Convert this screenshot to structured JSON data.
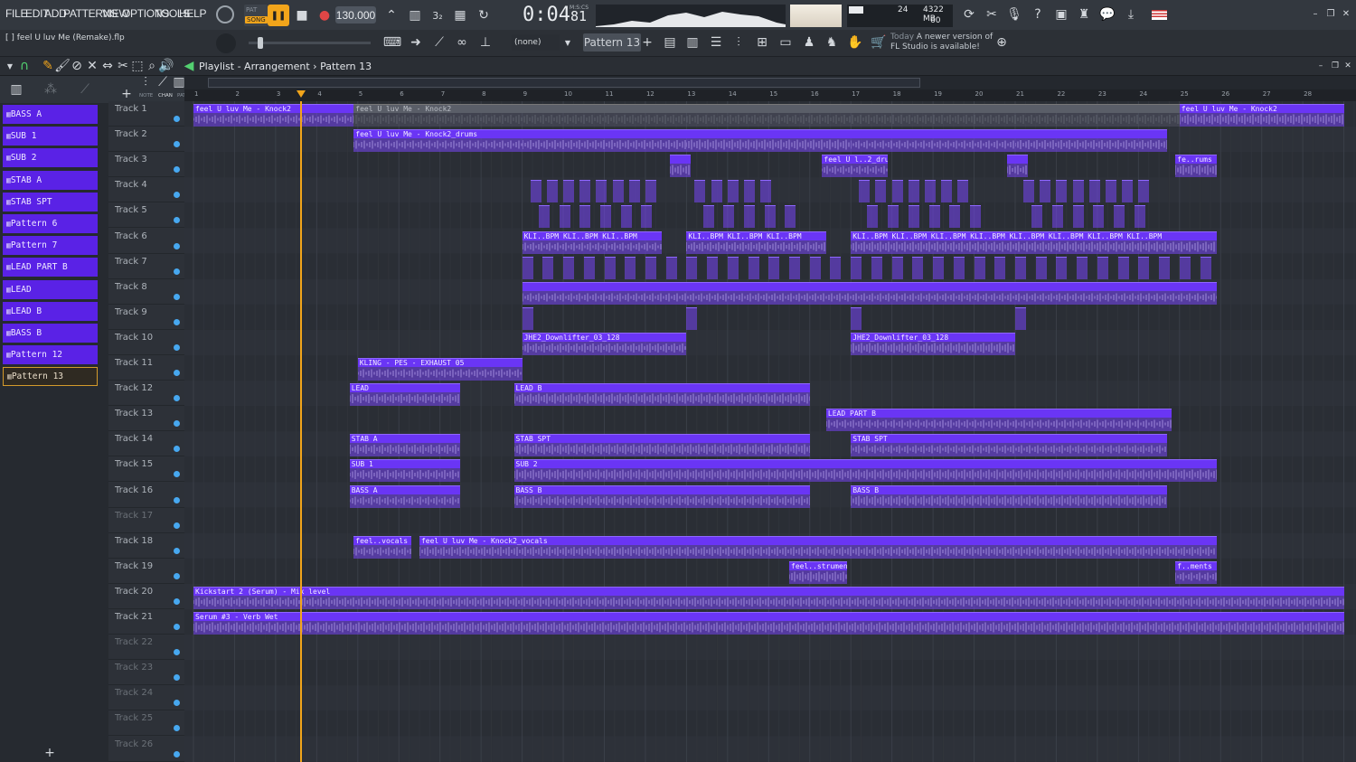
{
  "menu": [
    "FILE",
    "EDIT",
    "ADD",
    "PATTERNS",
    "VIEW",
    "OPTIONS",
    "TOOLS",
    "HELP"
  ],
  "transport": {
    "pat_label": "PAT",
    "song_label": "SONG",
    "tempo": "130.000",
    "time_main": "0:04",
    "time_sub": "81",
    "time_format": "M:S:CS"
  },
  "monitor": {
    "cpu": "24",
    "memory": "4322 MB",
    "polyphony": "60"
  },
  "project_title": "[ ] feel U luv Me (Remake).flp",
  "toolbar": {
    "snap": "(none)",
    "pattern": "Pattern 13"
  },
  "notice": {
    "date": "Today",
    "line1": "A newer version of",
    "line2": "FL Studio is available!"
  },
  "playlist": {
    "title": "Playlist - Arrangement",
    "crumb": "Pattern 13"
  },
  "chan_tabs": [
    "NOTE",
    "CHAN",
    "PAT"
  ],
  "patterns": [
    "BASS A",
    "SUB 1",
    "SUB 2",
    "STAB A",
    "STAB SPT",
    "Pattern 6",
    "Pattern 7",
    "LEAD PART B",
    "LEAD",
    "LEAD B",
    "BASS B",
    "Pattern 12",
    "Pattern 13"
  ],
  "selected_pattern": "Pattern 13",
  "tracks": [
    "Track 1",
    "Track 2",
    "Track 3",
    "Track 4",
    "Track 5",
    "Track 6",
    "Track 7",
    "Track 8",
    "Track 9",
    "Track 10",
    "Track 11",
    "Track 12",
    "Track 13",
    "Track 14",
    "Track 15",
    "Track 16",
    "Track 17",
    "Track 18",
    "Track 19",
    "Track 20",
    "Track 21",
    "Track 22",
    "Track 23",
    "Track 24",
    "Track 25",
    "Track 26"
  ],
  "ruler_bars": [
    "1",
    "2",
    "3",
    "4",
    "5",
    "6",
    "7",
    "8",
    "9",
    "10",
    "11",
    "12",
    "13",
    "14",
    "15",
    "16",
    "17",
    "18",
    "19",
    "20",
    "21",
    "22",
    "23",
    "24",
    "25",
    "26",
    "27",
    "28"
  ],
  "playhead_bar": 3.6,
  "clips": [
    {
      "track": 1,
      "start": 1,
      "end": 4.9,
      "label": "feel U luv Me - Knock2"
    },
    {
      "track": 1,
      "start": 4.9,
      "end": 25,
      "label": "feel U luv Me - Knock2",
      "muted": true
    },
    {
      "track": 1,
      "start": 25,
      "end": 29,
      "label": "feel U luv Me - Knock2"
    },
    {
      "track": 2,
      "start": 4.9,
      "end": 9,
      "label": "feel U luv Me - Knock2_drums"
    },
    {
      "track": 2,
      "start": 9,
      "end": 13,
      "label": ""
    },
    {
      "track": 2,
      "start": 13,
      "end": 17,
      "label": ""
    },
    {
      "track": 2,
      "start": 17,
      "end": 21,
      "label": ""
    },
    {
      "track": 2,
      "start": 21,
      "end": 24.7,
      "label": ""
    },
    {
      "track": 3,
      "start": 12.6,
      "end": 13.1,
      "label": ""
    },
    {
      "track": 3,
      "start": 16.3,
      "end": 17.9,
      "label": "feel U l..2_drums"
    },
    {
      "track": 3,
      "start": 20.8,
      "end": 21.3,
      "label": ""
    },
    {
      "track": 3,
      "start": 24.9,
      "end": 25.9,
      "label": "fe..rums"
    },
    {
      "track": 6,
      "start": 9,
      "end": 12.4,
      "label": "KLI..BPM  KLI..BPM  KLI..BPM"
    },
    {
      "track": 6,
      "start": 13,
      "end": 16.4,
      "label": "KLI..BPM  KLI..BPM  KLI..BPM"
    },
    {
      "track": 6,
      "start": 17,
      "end": 25.9,
      "label": "KLI..BPM  KLI..BPM  KLI..BPM  KLI..BPM  KLI..BPM  KLI..BPM  KLI..BPM  KLI..BPM"
    },
    {
      "track": 8,
      "start": 9,
      "end": 25.9,
      "label": ""
    },
    {
      "track": 10,
      "start": 9,
      "end": 13,
      "label": "JHE2_Downlifter_03_128"
    },
    {
      "track": 10,
      "start": 17,
      "end": 21,
      "label": "JHE2_Downlifter_03_128"
    },
    {
      "track": 11,
      "start": 5,
      "end": 9,
      "label": "KLING - PES - EXHAUST 05"
    },
    {
      "track": 12,
      "start": 4.8,
      "end": 7.5,
      "label": "LEAD"
    },
    {
      "track": 12,
      "start": 8.8,
      "end": 16,
      "label": "LEAD B"
    },
    {
      "track": 13,
      "start": 16.4,
      "end": 24.8,
      "label": "LEAD PART B"
    },
    {
      "track": 14,
      "start": 4.8,
      "end": 7.5,
      "label": "STAB A"
    },
    {
      "track": 14,
      "start": 8.8,
      "end": 16,
      "label": "STAB SPT"
    },
    {
      "track": 14,
      "start": 17,
      "end": 24.7,
      "label": "STAB SPT"
    },
    {
      "track": 15,
      "start": 4.8,
      "end": 7.5,
      "label": "SUB 1"
    },
    {
      "track": 15,
      "start": 8.8,
      "end": 25.9,
      "label": "SUB 2"
    },
    {
      "track": 16,
      "start": 4.8,
      "end": 7.5,
      "label": "BASS A"
    },
    {
      "track": 16,
      "start": 8.8,
      "end": 16,
      "label": "BASS B"
    },
    {
      "track": 16,
      "start": 17,
      "end": 24.7,
      "label": "BASS B"
    },
    {
      "track": 18,
      "start": 4.9,
      "end": 6.3,
      "label": "feel..vocals"
    },
    {
      "track": 18,
      "start": 6.5,
      "end": 25.9,
      "label": "feel U luv Me - Knock2_vocals"
    },
    {
      "track": 19,
      "start": 15.5,
      "end": 16.9,
      "label": "feel..struments"
    },
    {
      "track": 19,
      "start": 24.9,
      "end": 25.9,
      "label": "f..ments"
    },
    {
      "track": 20,
      "start": 1,
      "end": 29,
      "label": "Kickstart 2 (Serum) - Mix level"
    },
    {
      "track": 21,
      "start": 1,
      "end": 29,
      "label": "Serum #3 - Verb Wet"
    }
  ],
  "colors": {
    "accent": "#6a35f5",
    "clip": "#7646f5",
    "playhead": "#f2a51b",
    "background": "#2a2e35"
  }
}
